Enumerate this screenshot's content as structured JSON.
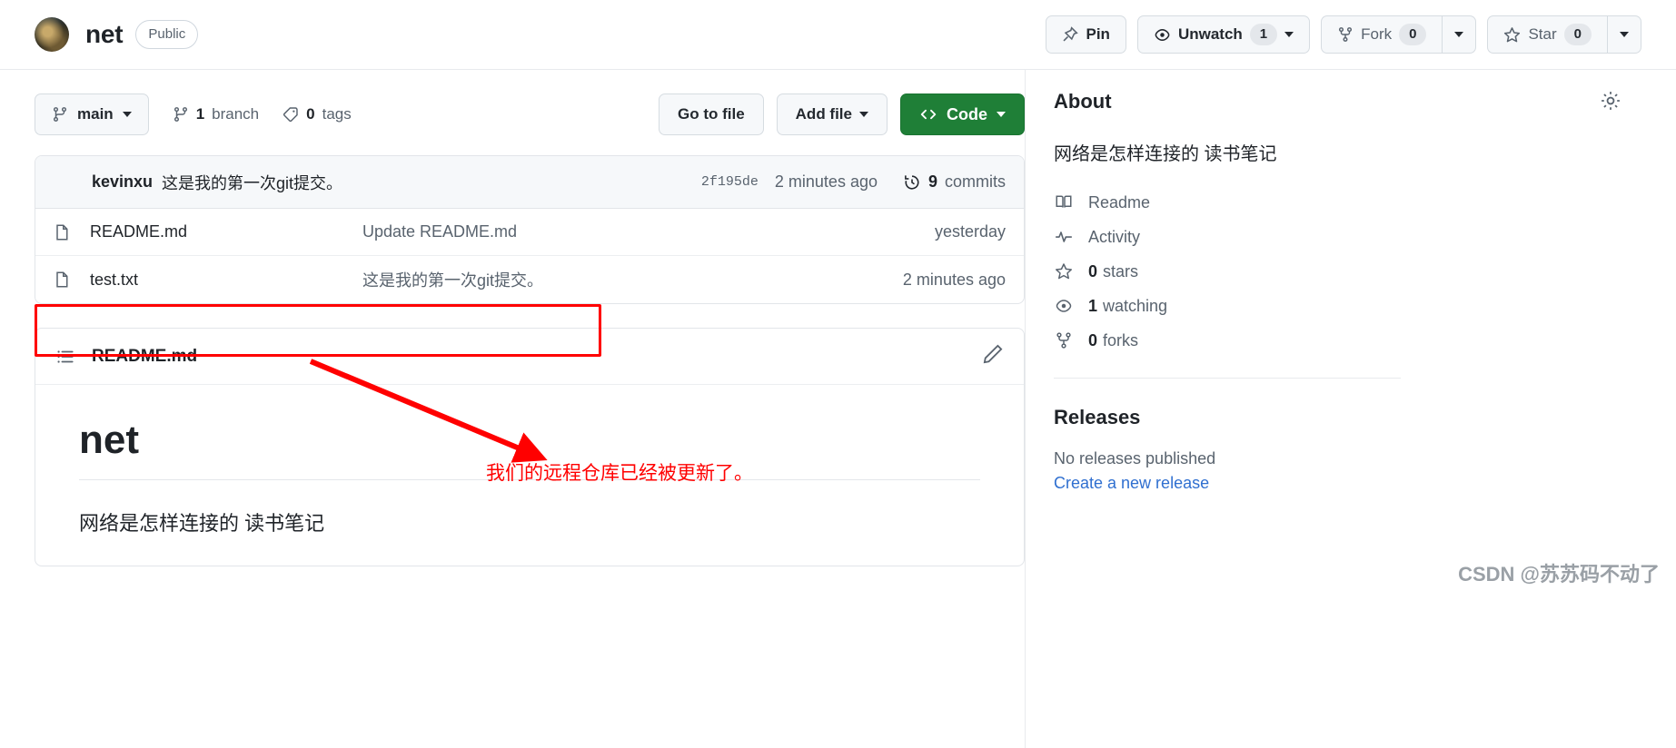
{
  "repo": {
    "name": "net",
    "visibility": "Public",
    "avatar_icon": "user-avatar"
  },
  "header_actions": {
    "pin_label": "Pin",
    "pin_icon": "pin-icon",
    "unwatch_label": "Unwatch",
    "unwatch_count": "1",
    "unwatch_icon": "eye-icon",
    "fork_label": "Fork",
    "fork_count": "0",
    "fork_icon": "fork-icon",
    "star_label": "Star",
    "star_count": "0",
    "star_icon": "star-icon"
  },
  "toolbar": {
    "branch_label": "main",
    "branch_icon": "branch-icon",
    "branches_count": "1",
    "branches_label": "branch",
    "tags_count": "0",
    "tags_label": "tags",
    "tags_icon": "tag-icon",
    "go_to_file": "Go to file",
    "add_file": "Add file",
    "code_label": "Code",
    "code_icon": "code-brackets-icon"
  },
  "commit_bar": {
    "author": "kevinxu",
    "message": "这是我的第一次git提交。",
    "sha": "2f195de",
    "time": "2 minutes ago",
    "commits_count": "9",
    "commits_label": "commits",
    "history_icon": "history-icon"
  },
  "files": [
    {
      "name": "README.md",
      "message": "Update README.md",
      "time": "yesterday",
      "icon": "file-icon",
      "highlighted": false
    },
    {
      "name": "test.txt",
      "message": "这是我的第一次git提交。",
      "time": "2 minutes ago",
      "icon": "file-icon",
      "highlighted": true
    }
  ],
  "readme": {
    "panel_title": "README.md",
    "list_icon": "list-unordered-icon",
    "edit_icon": "pencil-icon",
    "heading": "net",
    "paragraph": "网络是怎样连接的 读书笔记"
  },
  "about": {
    "title": "About",
    "settings_icon": "gear-icon",
    "description": "网络是怎样连接的 读书笔记",
    "items": [
      {
        "label": "Readme",
        "icon": "book-icon",
        "value": ""
      },
      {
        "label": "Activity",
        "icon": "pulse-icon",
        "value": ""
      },
      {
        "label": "stars",
        "icon": "star-icon",
        "value": "0"
      },
      {
        "label": "watching",
        "icon": "eye-icon",
        "value": "1"
      },
      {
        "label": "forks",
        "icon": "fork-icon",
        "value": "0"
      }
    ]
  },
  "releases": {
    "title": "Releases",
    "empty_text": "No releases published",
    "create_link": "Create a new release"
  },
  "annotations": {
    "note_text": "我们的远程仓库已经被更新了。",
    "color": "#ff0000"
  },
  "watermark": "CSDN @苏苏码不动了"
}
